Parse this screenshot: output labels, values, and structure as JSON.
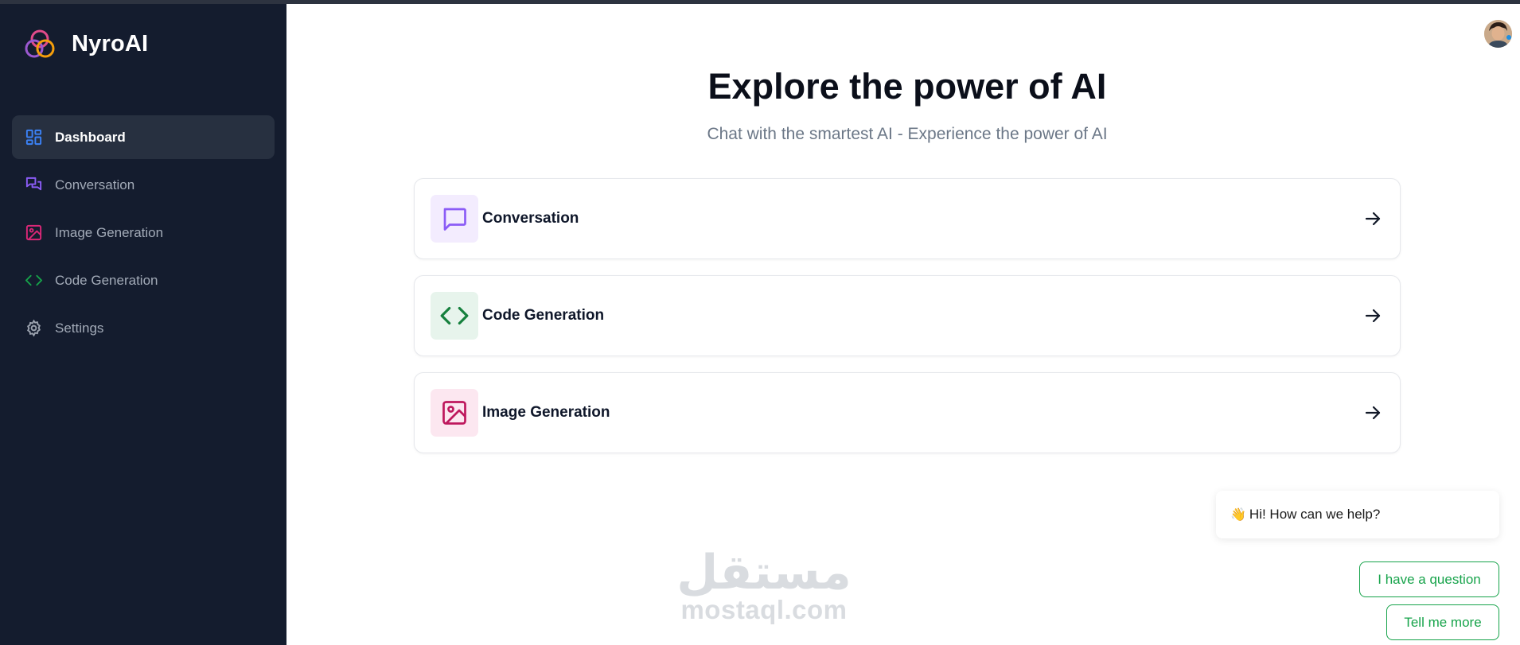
{
  "app": {
    "name": "NyroAI"
  },
  "sidebar": {
    "items": [
      {
        "label": "Dashboard",
        "icon": "dashboard-icon",
        "active": true,
        "color": "#3b82f6"
      },
      {
        "label": "Conversation",
        "icon": "chat-icon",
        "active": false,
        "color": "#8b5cf6"
      },
      {
        "label": "Image Generation",
        "icon": "image-icon",
        "active": false,
        "color": "#db2777"
      },
      {
        "label": "Code Generation",
        "icon": "code-icon",
        "active": false,
        "color": "#16a34a"
      },
      {
        "label": "Settings",
        "icon": "gear-icon",
        "active": false,
        "color": "#9ca3af"
      }
    ]
  },
  "header": {
    "title": "Explore the power of AI",
    "subtitle": "Chat with the smartest AI - Experience the power of AI"
  },
  "tools": [
    {
      "label": "Conversation",
      "icon": "chat-icon",
      "color": "#8b5cf6",
      "bg": "#f3ecfe"
    },
    {
      "label": "Code Generation",
      "icon": "code-icon",
      "color": "#15803d",
      "bg": "#e7f4ec"
    },
    {
      "label": "Image Generation",
      "icon": "image-icon",
      "color": "#be185d",
      "bg": "#fce7f0"
    }
  ],
  "chat_widget": {
    "greeting_emoji": "👋",
    "greeting": "Hi! How can we help?",
    "buttons": [
      "I have a question",
      "Tell me more"
    ],
    "accent": "#16a34a"
  },
  "watermark": {
    "arabic": "مستقل",
    "latin": "mostaql.com"
  }
}
